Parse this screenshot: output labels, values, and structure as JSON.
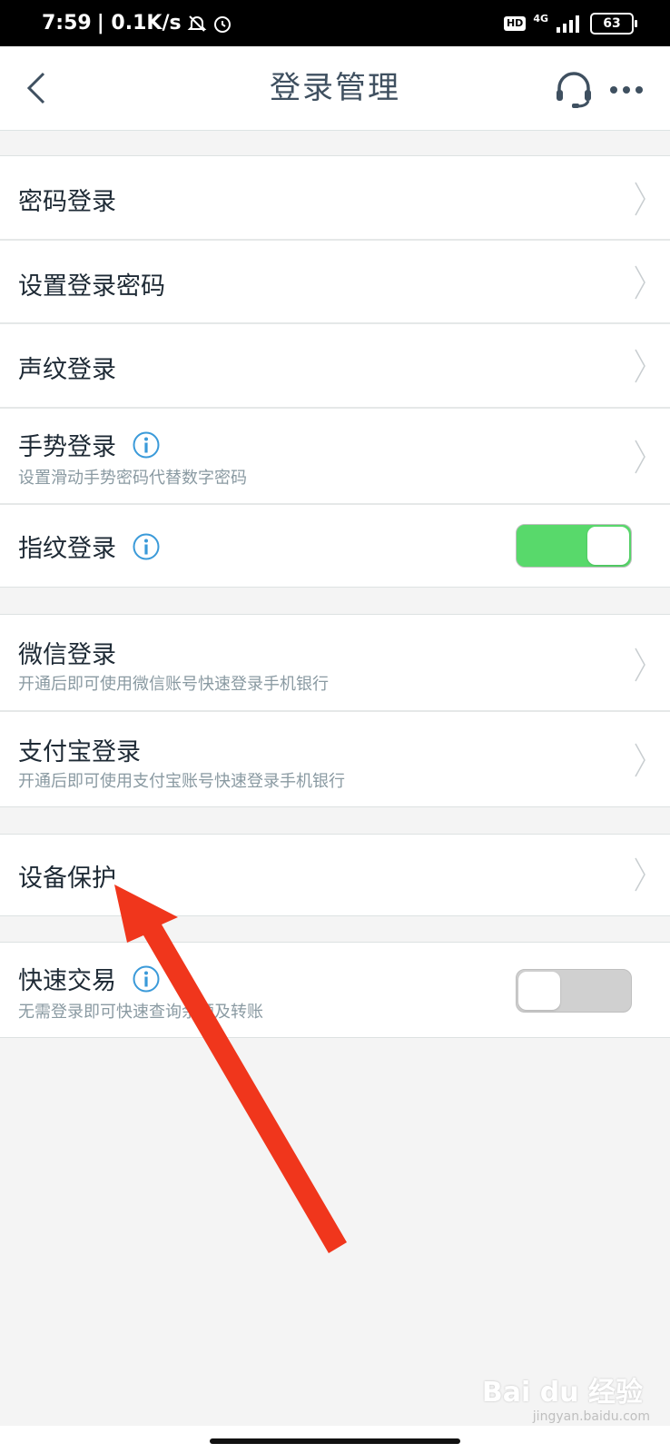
{
  "status_bar": {
    "time": "7:59",
    "speed": "| 0.1K/s",
    "hd": "HD",
    "network": "4G",
    "battery": "63"
  },
  "header": {
    "title": "登录管理"
  },
  "groups": [
    {
      "rows": [
        {
          "title": "密码登录"
        },
        {
          "title": "设置登录密码"
        },
        {
          "title": "声纹登录"
        },
        {
          "title": "手势登录",
          "subtitle": "设置滑动手势密码代替数字密码"
        },
        {
          "title": "指纹登录",
          "toggle": "on"
        }
      ]
    },
    {
      "rows": [
        {
          "title": "微信登录",
          "subtitle": "开通后即可使用微信账号快速登录手机银行"
        },
        {
          "title": "支付宝登录",
          "subtitle": "开通后即可使用支付宝账号快速登录手机银行"
        }
      ]
    },
    {
      "rows": [
        {
          "title": "设备保护"
        }
      ]
    },
    {
      "rows": [
        {
          "title": "快速交易",
          "subtitle": "无需登录即可快速查询余额及转账",
          "toggle": "off"
        }
      ]
    }
  ],
  "watermark": {
    "brand": "Bai du 经验",
    "url": "jingyan.baidu.com"
  },
  "colors": {
    "toggle_on": "#58d96b",
    "toggle_off": "#d0d0d0",
    "info_icon": "#3a9ad9",
    "annotation_arrow": "#f0361c"
  }
}
